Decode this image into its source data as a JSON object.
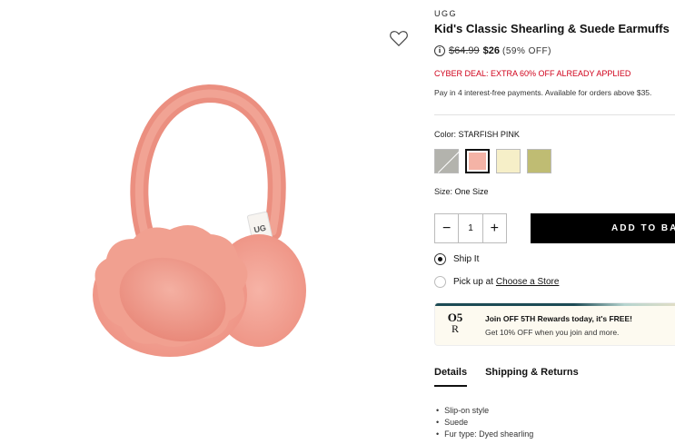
{
  "product": {
    "brand": "UGG",
    "title": "Kid's Classic Shearling & Suede Earmuffs",
    "original_price": "$64.99",
    "sale_price": "$26",
    "discount": "(59% OFF)",
    "deal_text": "CYBER DEAL: EXTRA 60% OFF ALREADY APPLIED",
    "pay_text": "Pay in 4 interest-free payments. Available for orders above $35."
  },
  "color": {
    "label": "Color:",
    "selected_name": "STARFISH PINK",
    "swatches": [
      {
        "name": "grey",
        "hex": "#b3b3ad",
        "available": false
      },
      {
        "name": "starfish-pink",
        "hex": "#f4b3a6",
        "available": true,
        "selected": true
      },
      {
        "name": "cream",
        "hex": "#f6efc8",
        "available": true
      },
      {
        "name": "olive",
        "hex": "#bfbc73",
        "available": true
      }
    ]
  },
  "size": {
    "label": "Size:",
    "value": "One Size"
  },
  "quantity": {
    "minus": "−",
    "value": "1",
    "plus": "+"
  },
  "add_to_bag": "ADD TO BAG",
  "fulfillment": {
    "ship_label": "Ship It",
    "pickup_prefix": "Pick up at",
    "pickup_link": "Choose a Store"
  },
  "rewards": {
    "logo_top": "O5",
    "logo_bottom": "R",
    "title": "Join OFF 5TH Rewards today, it's FREE!",
    "subtitle": "Get 10% OFF when you join and more."
  },
  "tabs": [
    {
      "label": "Details",
      "active": true
    },
    {
      "label": "Shipping & Returns",
      "active": false
    }
  ],
  "details": [
    "Slip-on style",
    "Suede",
    "Fur type: Dyed shearling"
  ],
  "colors": {
    "deal_red": "#d0021b",
    "button_black": "#000000",
    "earmuff_pink": "#f2a395"
  }
}
